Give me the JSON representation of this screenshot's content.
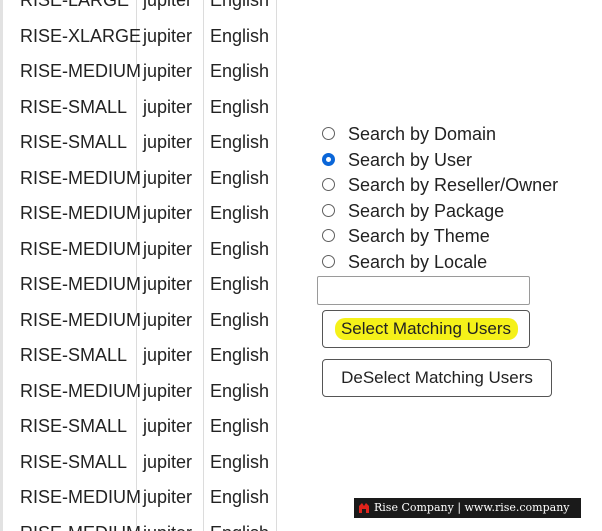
{
  "table": {
    "rows": [
      {
        "package": "RISE-LARGE",
        "theme": "jupiter",
        "locale": "English"
      },
      {
        "package": "RISE-XLARGE",
        "theme": "jupiter",
        "locale": "English"
      },
      {
        "package": "RISE-MEDIUM",
        "theme": "jupiter",
        "locale": "English"
      },
      {
        "package": "RISE-SMALL",
        "theme": "jupiter",
        "locale": "English"
      },
      {
        "package": "RISE-SMALL",
        "theme": "jupiter",
        "locale": "English"
      },
      {
        "package": "RISE-MEDIUM",
        "theme": "jupiter",
        "locale": "English"
      },
      {
        "package": "RISE-MEDIUM",
        "theme": "jupiter",
        "locale": "English"
      },
      {
        "package": "RISE-MEDIUM",
        "theme": "jupiter",
        "locale": "English"
      },
      {
        "package": "RISE-MEDIUM",
        "theme": "jupiter",
        "locale": "English"
      },
      {
        "package": "RISE-MEDIUM",
        "theme": "jupiter",
        "locale": "English"
      },
      {
        "package": "RISE-SMALL",
        "theme": "jupiter",
        "locale": "English"
      },
      {
        "package": "RISE-MEDIUM",
        "theme": "jupiter",
        "locale": "English"
      },
      {
        "package": "RISE-SMALL",
        "theme": "jupiter",
        "locale": "English"
      },
      {
        "package": "RISE-SMALL",
        "theme": "jupiter",
        "locale": "English"
      },
      {
        "package": "RISE-MEDIUM",
        "theme": "jupiter",
        "locale": "English"
      },
      {
        "package": "RISE-MEDIUM",
        "theme": "jupiter",
        "locale": "English"
      }
    ]
  },
  "search": {
    "options": [
      {
        "label": "Search by Domain",
        "checked": false
      },
      {
        "label": "Search by User",
        "checked": true
      },
      {
        "label": "Search by Reseller/Owner",
        "checked": false
      },
      {
        "label": "Search by Package",
        "checked": false
      },
      {
        "label": "Search by Theme",
        "checked": false
      },
      {
        "label": "Search by Locale",
        "checked": false
      }
    ],
    "input_value": "",
    "select_button": "Select Matching Users",
    "deselect_button": "DeSelect Matching Users"
  },
  "watermark": {
    "text": "Rise Company | www.rise.company"
  },
  "colors": {
    "highlight": "#f4f000",
    "radio_checked": "#0b66d8",
    "watermark_bg": "#1a1a1a",
    "watermark_logo": "#e0231b"
  }
}
